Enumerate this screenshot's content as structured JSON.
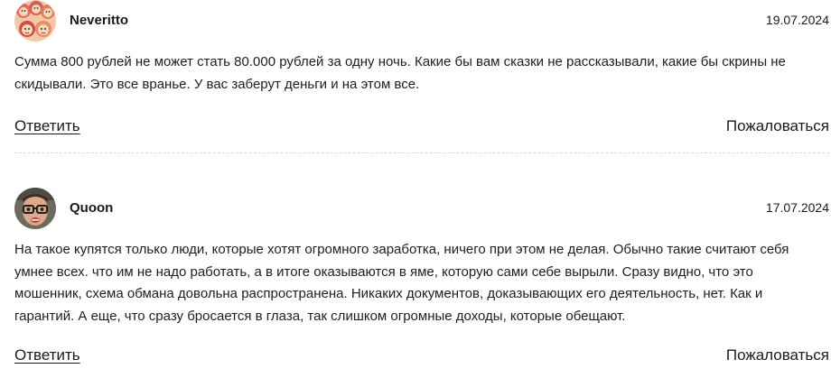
{
  "comments": [
    {
      "author": "Neveritto",
      "date": "19.07.2024",
      "avatar": "group-of-cartoon-faces-avatar",
      "text": "Сумма 800 рублей не может стать 80.000 рублей за одну ночь. Какие бы вам сказки не рассказывали, какие бы скрины не скидывали. Это все вранье. У вас заберут деньги и на этом все.",
      "reply_label": "Ответить",
      "report_label": "Пожаловаться"
    },
    {
      "author": "Quoon",
      "date": "17.07.2024",
      "avatar": "man-with-glasses-avatar",
      "text": "На такое купятся только люди, которые хотят огромного заработка, ничего при этом не делая. Обычно такие считают себя умнее всех. что им не надо работать, а в итоге оказываются в яме, которую сами себе вырыли. Сразу видно, что это мошенник, схема обмана довольна распространена. Никаких документов, доказывающих его деятельность, нет. Как и гарантий. А еще, что сразу бросается в глаза, так слишком огромные доходы, которые обещают.",
      "reply_label": "Ответить",
      "report_label": "Пожаловаться"
    }
  ],
  "colors": {
    "text": "#1e1e1e",
    "divider": "#dcdcdc",
    "background": "#ffffff"
  }
}
